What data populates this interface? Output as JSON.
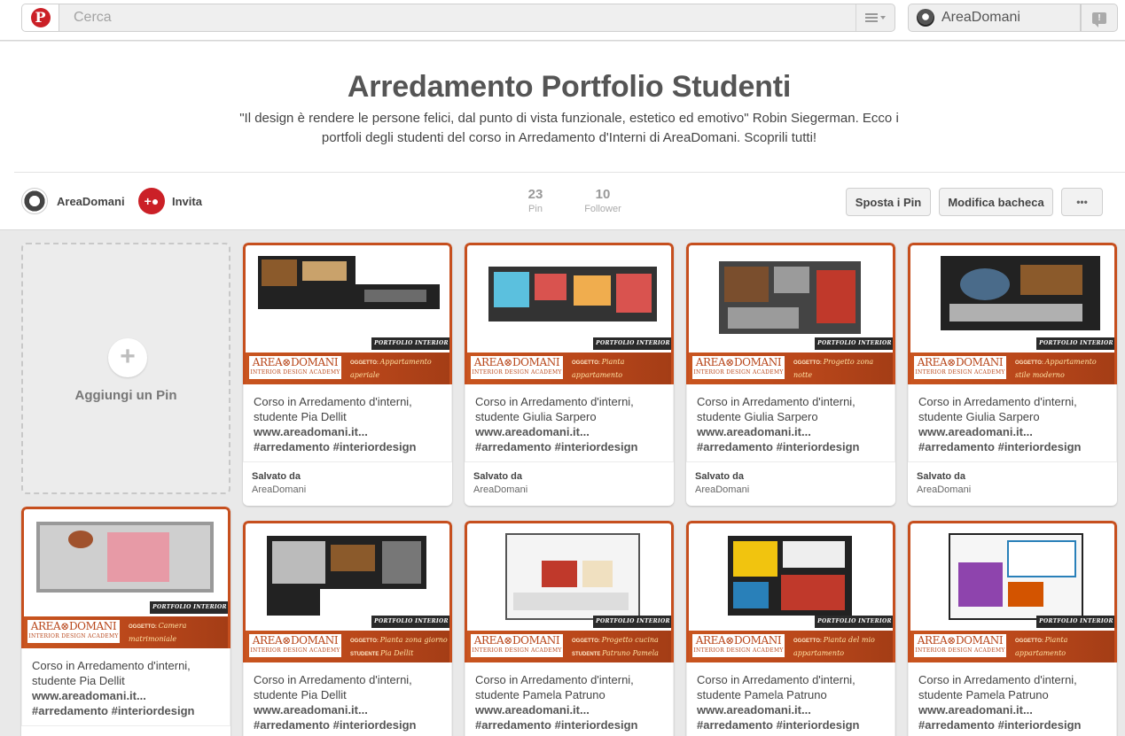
{
  "topbar": {
    "search_placeholder": "Cerca",
    "user_name": "AreaDomani"
  },
  "board": {
    "title": "Arredamento Portfolio Studenti",
    "description": "\"Il design è rendere le persone felici, dal punto di vista funzionale, estetico ed emotivo\" Robin Siegerman. Ecco i portfoli degli studenti del corso in Arredamento d'Interni di AreaDomani. Scoprili tutti!",
    "owner": "AreaDomani",
    "invite_label": "Invita",
    "pins_count": "23",
    "pins_label": "Pin",
    "followers_count": "10",
    "followers_label": "Follower",
    "move_pins_label": "Sposta i Pin",
    "edit_board_label": "Modifica bacheca",
    "more_label": "•••"
  },
  "add_pin_label": "Aggiungi un Pin",
  "brand": {
    "main": "AREA⊗DOMANI",
    "sub": "INTERIOR DESIGN ACADEMY",
    "tag": "PORTFOLIO INTERIOR DESIGN",
    "field_object": "OGGETTO:",
    "field_student": "STUDENTE"
  },
  "pins": [
    {
      "line1": "Corso in Arredamento d'interni,",
      "line2": "studente Pia Dellit",
      "link": "www.areadomani.it...",
      "tags": "#arredamento #interiordesign",
      "saved_label": "Salvato da",
      "saved_by": "AreaDomani",
      "object": "Appartamento aperiale",
      "student": "Pia Dellit"
    },
    {
      "line1": "Corso in Arredamento d'interni,",
      "line2": "studente Giulia Sarpero",
      "link": "www.areadomani.it...",
      "tags": "#arredamento #interiordesign",
      "saved_label": "Salvato da",
      "saved_by": "AreaDomani",
      "object": "Pianta appartamento",
      "student": "Giulia Sarpero"
    },
    {
      "line1": "Corso in Arredamento d'interni,",
      "line2": "studente Giulia Sarpero",
      "link": "www.areadomani.it...",
      "tags": "#arredamento #interiordesign",
      "saved_label": "Salvato da",
      "saved_by": "AreaDomani",
      "object": "Progetto zona notte",
      "student": "Giulia Sarpero"
    },
    {
      "line1": "Corso in Arredamento d'interni,",
      "line2": "studente Giulia Sarpero",
      "link": "www.areadomani.it...",
      "tags": "#arredamento #interiordesign",
      "saved_label": "Salvato da",
      "saved_by": "AreaDomani",
      "object": "Appartamento stile moderno",
      "student": "Giulia Sarpero"
    },
    {
      "line1": "Corso in Arredamento d'interni,",
      "line2": "studente Pia Dellit",
      "link": "www.areadomani.it...",
      "tags": "#arredamento #interiordesign",
      "object": "Camera matrimoniale",
      "student": "Pia Dellit"
    },
    {
      "line1": "Corso in Arredamento d'interni,",
      "line2": "studente Pia Dellit",
      "link": "www.areadomani.it...",
      "tags": "#arredamento #interiordesign",
      "object": "Pianta zona giorno",
      "student": "Pia Dellit"
    },
    {
      "line1": "Corso in Arredamento d'interni,",
      "line2": "studente Pamela Patruno",
      "link": "www.areadomani.it...",
      "tags": "#arredamento #interiordesign",
      "object": "Progetto cucina",
      "student": "Patruno Pamela"
    },
    {
      "line1": "Corso in Arredamento d'interni,",
      "line2": "studente Pamela Patruno",
      "link": "www.areadomani.it...",
      "tags": "#arredamento #interiordesign",
      "object": "Pianta del mio appartamento",
      "student": "Patruno Pamela"
    },
    {
      "line1": "Corso in Arredamento d'interni,",
      "line2": "studente Pamela Patruno",
      "link": "www.areadomani.it...",
      "tags": "#arredamento #interiordesign",
      "object": "Pianta appartamento",
      "student": "Patruno Pamela"
    }
  ]
}
